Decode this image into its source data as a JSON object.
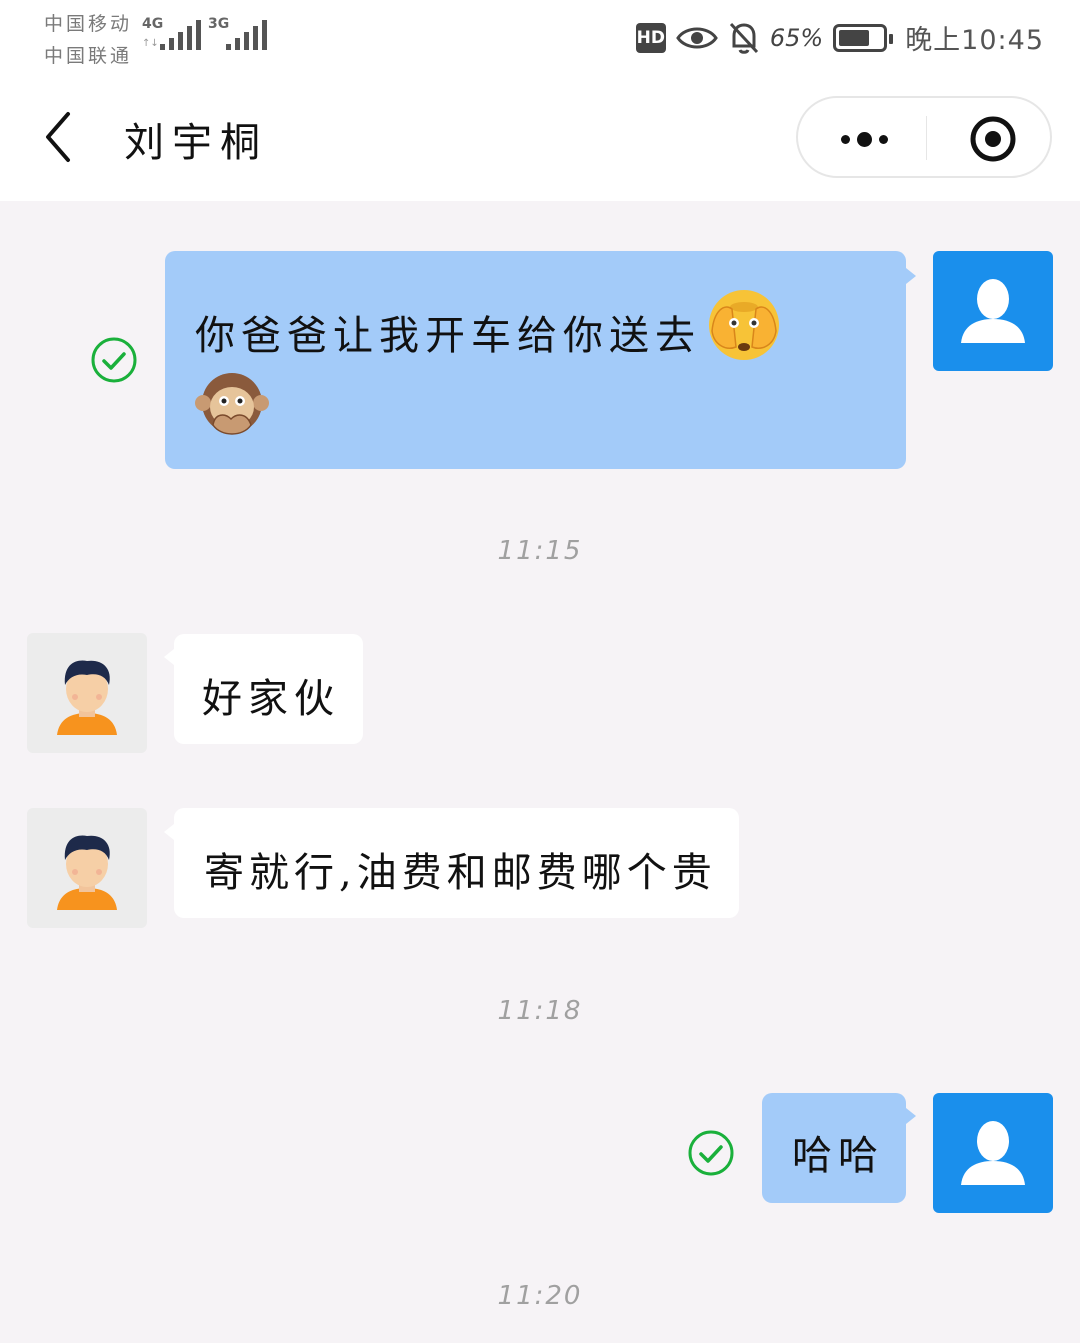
{
  "status": {
    "carrier1": "中国移动",
    "carrier2": "中国联通",
    "net1": "4G",
    "net2": "3G",
    "hd": "HD",
    "battery_pct": "65%",
    "time": "晚上10:45"
  },
  "header": {
    "title": "刘宇桐"
  },
  "messages": [
    {
      "from": "me",
      "text": "你爸爸让我开车给你送去",
      "status": "sent"
    },
    {
      "time": "11:15"
    },
    {
      "from": "other",
      "text": "好家伙"
    },
    {
      "from": "other",
      "text": "寄就行,油费和邮费哪个贵"
    },
    {
      "time": "11:18"
    },
    {
      "from": "me",
      "text": "哈哈",
      "status": "sent"
    },
    {
      "time": "11:20"
    }
  ],
  "colors": {
    "my_bubble": "#a3cbf9",
    "my_avatar": "#1a8fec",
    "check_green": "#1ab03b",
    "background": "#f6f3f6"
  },
  "icons": {
    "back": "chevron-left-icon",
    "more": "more-dots-icon",
    "close": "target-close-icon",
    "sent": "check-circle-icon",
    "emoji1": "face-covering-eyes-emoji",
    "emoji2": "speak-no-evil-monkey-emoji"
  }
}
